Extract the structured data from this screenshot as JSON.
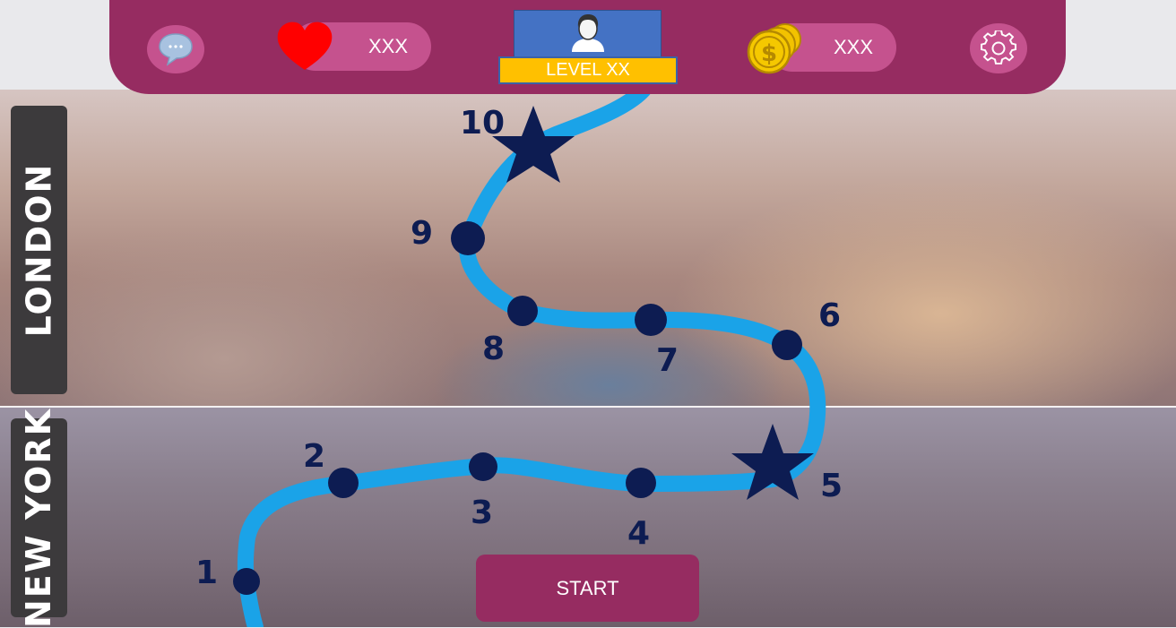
{
  "hud": {
    "lives_value": "XXX",
    "coins_value": "XXX",
    "level_label": "LEVEL XX"
  },
  "cities": [
    {
      "name": "LONDON"
    },
    {
      "name": "NEW YORK"
    }
  ],
  "levels": [
    {
      "number": "1",
      "type": "dot"
    },
    {
      "number": "2",
      "type": "dot"
    },
    {
      "number": "3",
      "type": "dot"
    },
    {
      "number": "4",
      "type": "dot"
    },
    {
      "number": "5",
      "type": "star"
    },
    {
      "number": "6",
      "type": "dot"
    },
    {
      "number": "7",
      "type": "dot"
    },
    {
      "number": "8",
      "type": "dot"
    },
    {
      "number": "9",
      "type": "dot"
    },
    {
      "number": "10",
      "type": "star"
    }
  ],
  "start_button": {
    "label": "START"
  },
  "colors": {
    "hud_bg": "#962c61",
    "pill_bg": "#c5528e",
    "path": "#1aa3e8",
    "node": "#0d1c52",
    "level_badge": "#ffc000",
    "avatar_bg": "#4472c4",
    "heart": "#ff0000",
    "coin": "#f2c200"
  },
  "icons": [
    "chat-icon",
    "heart-icon",
    "coin-stack-icon",
    "gear-icon",
    "avatar-icon",
    "star-icon"
  ]
}
